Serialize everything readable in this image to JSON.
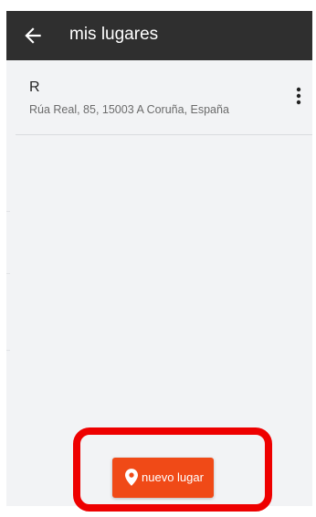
{
  "app": {
    "title": "mis lugares"
  },
  "places": [
    {
      "name": "R",
      "address": "Rúa Real, 85, 15003 A Coruña, España"
    }
  ],
  "fab": {
    "label": "nuevo lugar"
  },
  "icons": {
    "back": "arrow-left-icon",
    "more": "more-vert-icon",
    "pin": "map-pin-icon"
  },
  "colors": {
    "appbar": "#2f2f2f",
    "accent": "#f04a17",
    "highlight": "#ee0000",
    "background": "#f2f3f5"
  }
}
